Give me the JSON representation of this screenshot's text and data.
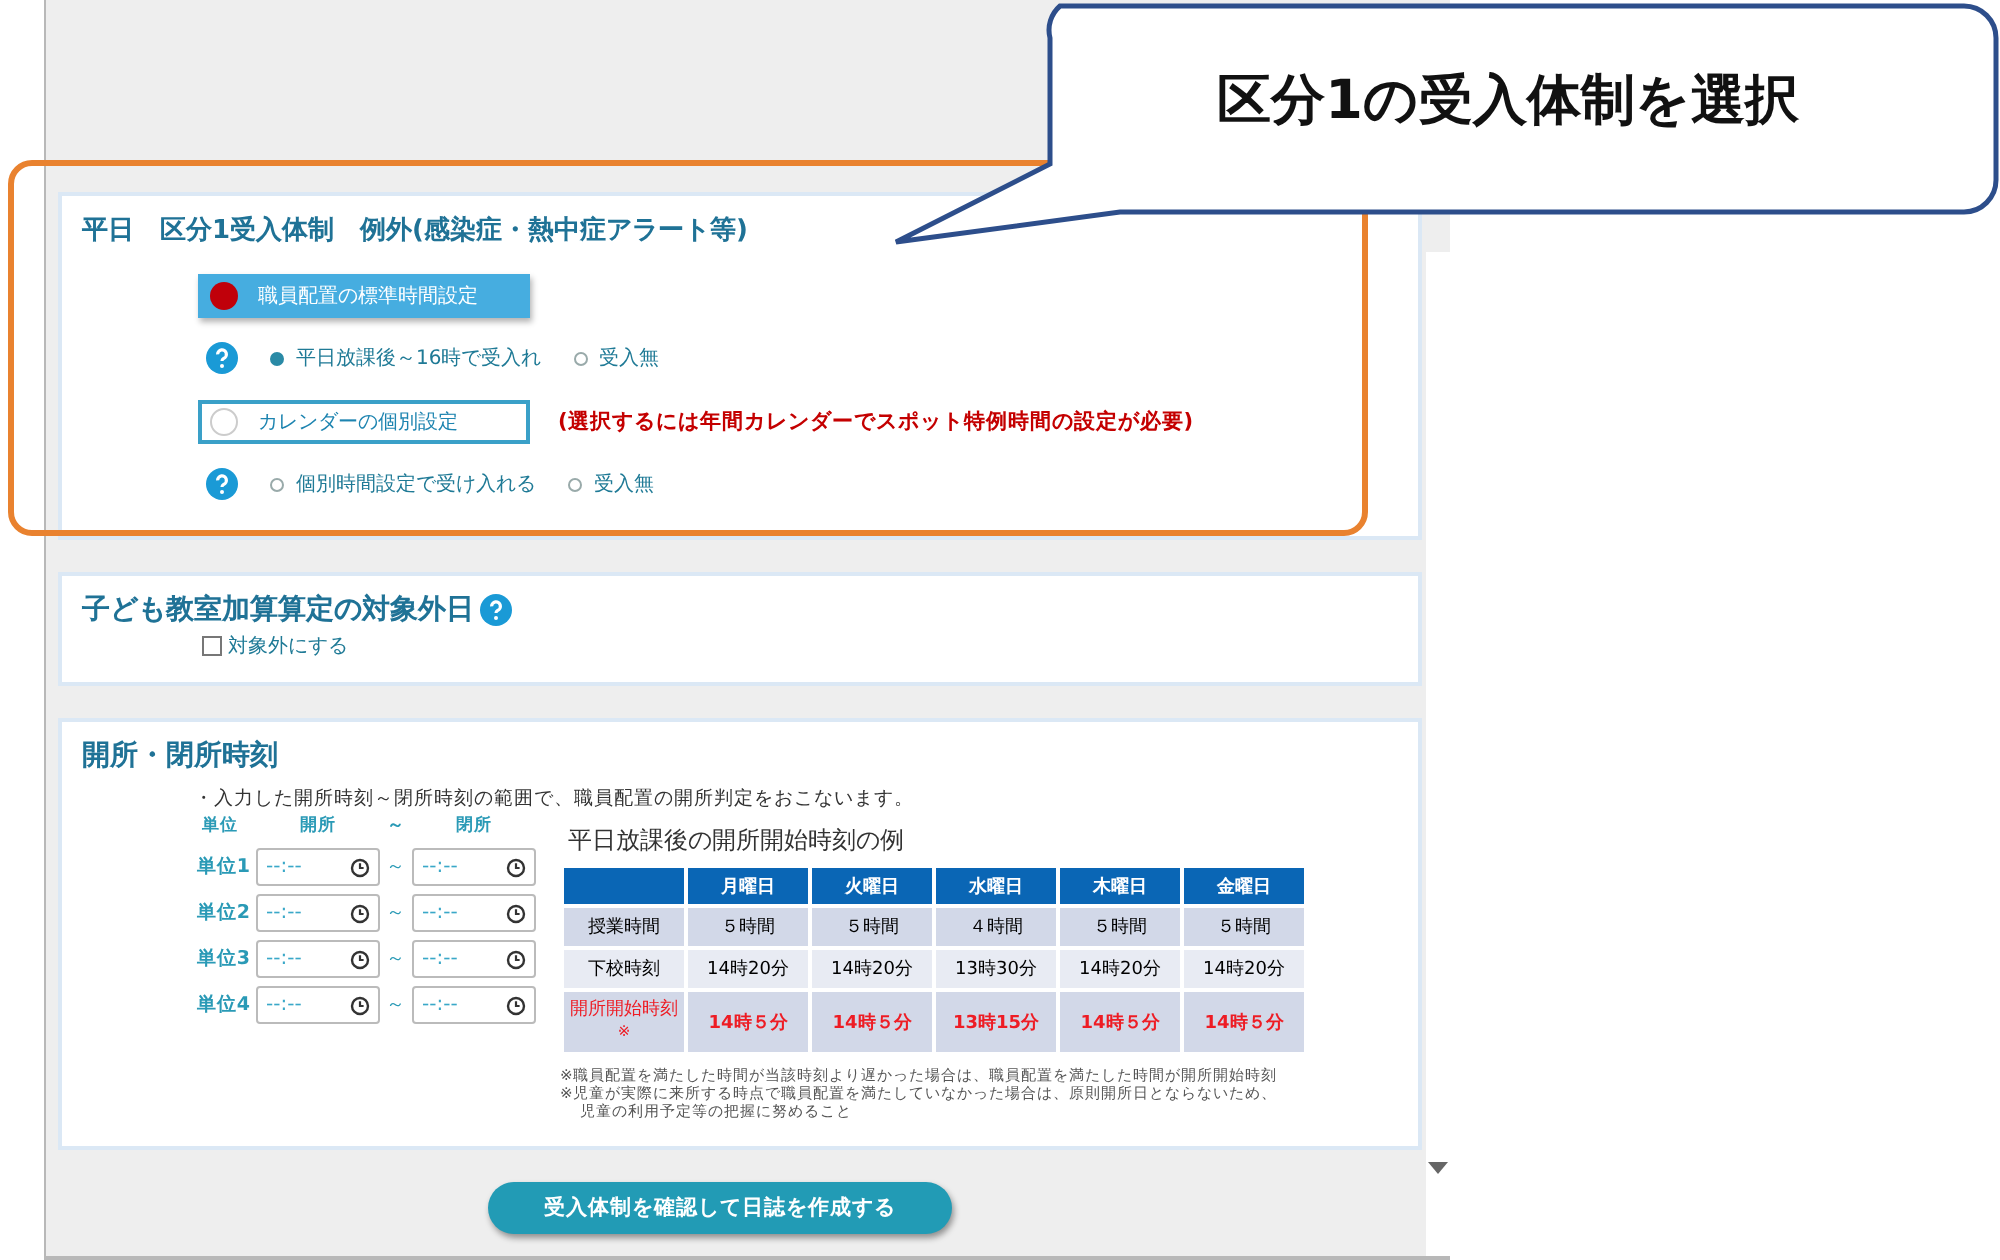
{
  "callout": {
    "text": "区分1の受入体制を選択"
  },
  "acceptance": {
    "title": "平日　区分1受入体制　例外(感染症・熱中症アラート等)",
    "options": [
      {
        "label": "職員配置の標準時間設定",
        "selected": true,
        "sub_options": [
          {
            "label": "平日放課後～16時で受入れ",
            "selected": true
          },
          {
            "label": "受入無",
            "selected": false
          }
        ]
      },
      {
        "label": "カレンダーの個別設定",
        "selected": false,
        "note": "(選択するには年間カレンダーでスポット特例時間の設定が必要)",
        "sub_options": [
          {
            "label": "個別時間設定で受け入れる",
            "selected": false
          },
          {
            "label": "受入無",
            "selected": false
          }
        ]
      }
    ]
  },
  "exclusion": {
    "title": "子ども教室加算算定の対象外日",
    "checkbox": {
      "label": "対象外にする",
      "checked": false
    }
  },
  "hours": {
    "title": "開所・閉所時刻",
    "description": "・入力した開所時刻～閉所時刻の範囲で、職員配置の開所判定をおこないます。",
    "headers": [
      "単位",
      "開所",
      "～",
      "閉所"
    ],
    "units": [
      {
        "label": "単位1",
        "open": {
          "placeholder": "--:--"
        },
        "separator": "～",
        "close": {
          "placeholder": "--:--"
        }
      },
      {
        "label": "単位2",
        "open": {
          "placeholder": "--:--"
        },
        "separator": "～",
        "close": {
          "placeholder": "--:--"
        }
      },
      {
        "label": "単位3",
        "open": {
          "placeholder": "--:--"
        },
        "separator": "～",
        "close": {
          "placeholder": "--:--"
        }
      },
      {
        "label": "単位4",
        "open": {
          "placeholder": "--:--"
        },
        "separator": "～",
        "close": {
          "placeholder": "--:--"
        }
      }
    ],
    "example": {
      "title": "平日放課後の開所開始時刻の例",
      "columns": [
        "月曜日",
        "火曜日",
        "水曜日",
        "木曜日",
        "金曜日"
      ],
      "rows": [
        {
          "kind": "normal",
          "label": "授業時間",
          "cells": [
            "５時間",
            "５時間",
            "４時間",
            "５時間",
            "５時間"
          ]
        },
        {
          "kind": "normal",
          "label": "下校時刻",
          "cells": [
            "14時20分",
            "14時20分",
            "13時30分",
            "14時20分",
            "14時20分"
          ]
        },
        {
          "kind": "emphasis",
          "label": "開所開始時刻$^{※}$",
          "cells": [
            "14時５分",
            "14時５分",
            "13時15分",
            "14時５分",
            "14時５分"
          ]
        }
      ],
      "notes": [
        "※職員配置を満たした時間が当該時刻より遅かった場合は、職員配置を満たした時間が開所開始時刻",
        "※児童が実際に来所する時点で職員配置を満たしていなかった場合は、原則開所日とならないため、",
        "児童の利用予定等の把握に努めること"
      ]
    }
  },
  "submit_button": "受入体制を確認して日誌を作成する"
}
